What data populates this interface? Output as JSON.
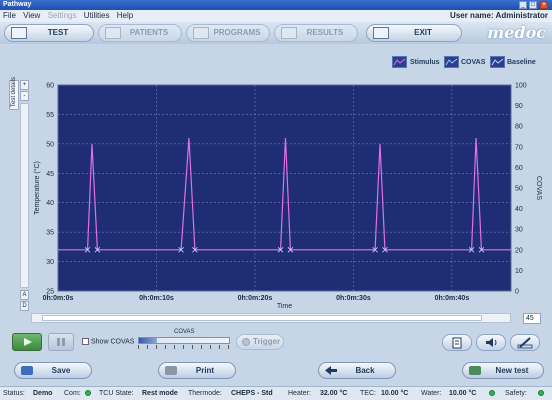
{
  "window": {
    "title": "Pathway",
    "controls": [
      "_",
      "□",
      "×"
    ]
  },
  "menu": {
    "items": [
      {
        "label": "File",
        "enabled": true
      },
      {
        "label": "View",
        "enabled": true
      },
      {
        "label": "Settings",
        "enabled": false
      },
      {
        "label": "Utilities",
        "enabled": true
      },
      {
        "label": "Help",
        "enabled": true
      }
    ],
    "user": "User name: Administrator"
  },
  "nav": {
    "test": "TEST",
    "patients": "PATIENTS",
    "programs": "PROGRAMS",
    "results": "RESULTS",
    "exit": "EXIT",
    "logo": "medoc"
  },
  "sidebar": {
    "test_details": "Test details",
    "zoom_in": "+",
    "zoom_out": "-",
    "btn_a": "A",
    "btn_d": "D"
  },
  "legend": {
    "stimulus": "Stimulus",
    "covas": "COVAS",
    "baseline": "Baseline"
  },
  "chart_data": {
    "type": "line",
    "xlabel": "Time",
    "ylabel": "Temperature (°C)",
    "y2label": "COVAS",
    "ylim": [
      25,
      60
    ],
    "y2lim": [
      0,
      100
    ],
    "yticks": [
      25,
      30,
      35,
      40,
      45,
      50,
      55,
      60
    ],
    "y2ticks": [
      0,
      10,
      20,
      30,
      40,
      50,
      60,
      70,
      80,
      90,
      100
    ],
    "xlim": [
      0,
      46
    ],
    "xticks": [
      {
        "value": 0,
        "label": "0h:0m:0s"
      },
      {
        "value": 10,
        "label": "0h:0m:10s"
      },
      {
        "value": 20,
        "label": "0h:0m:20s"
      },
      {
        "value": 30,
        "label": "0h:0m:30s"
      },
      {
        "value": 40,
        "label": "0h:0m:40s"
      }
    ],
    "grid": true,
    "colors": {
      "background": "#1f2d75",
      "stimulus": "#e070e8",
      "grid": "#7f8fc8",
      "markers": "#c9d2ff"
    },
    "series": [
      {
        "name": "Stimulus",
        "baseline": 32,
        "x": [
          0,
          3.0,
          3.45,
          4.0,
          12.5,
          13.3,
          13.9,
          22.6,
          23.1,
          23.6,
          32.2,
          32.7,
          33.2,
          42.0,
          42.45,
          43.0,
          51.8,
          52.2,
          52.8
        ],
        "y": [
          32,
          32,
          50,
          32,
          32,
          51,
          32,
          32,
          51,
          32,
          32,
          50,
          32,
          32,
          51,
          32,
          32,
          51,
          32
        ]
      }
    ],
    "markers_x": [
      3.0,
      4.0,
      12.5,
      13.9,
      22.6,
      23.6,
      32.2,
      33.2,
      42.0,
      43.0,
      51.8,
      52.8
    ],
    "markers_y": 32
  },
  "scroll": {
    "zoom_value": "45"
  },
  "controls": {
    "show_covas": "Show COVAS",
    "covas_label": "COVAS",
    "covas_level": 0.2,
    "trigger": "Trigger"
  },
  "actions": {
    "save": "Save",
    "print": "Print",
    "back": "Back",
    "new_test": "New test"
  },
  "status": {
    "status_label": "Status:",
    "status_value": "Demo",
    "com_label": "Com:",
    "tcu_label": "TCU State:",
    "tcu_value": "Rest mode",
    "thermode_label": "Thermode:",
    "thermode_value": "CHEPS - Std",
    "heater_label": "Heater:",
    "heater_value": "32.00 °C",
    "tec_label": "TEC:",
    "tec_value": "10.00 °C",
    "water_label": "Water:",
    "water_value": "10.00 °C",
    "safety_label": "Safety:"
  }
}
